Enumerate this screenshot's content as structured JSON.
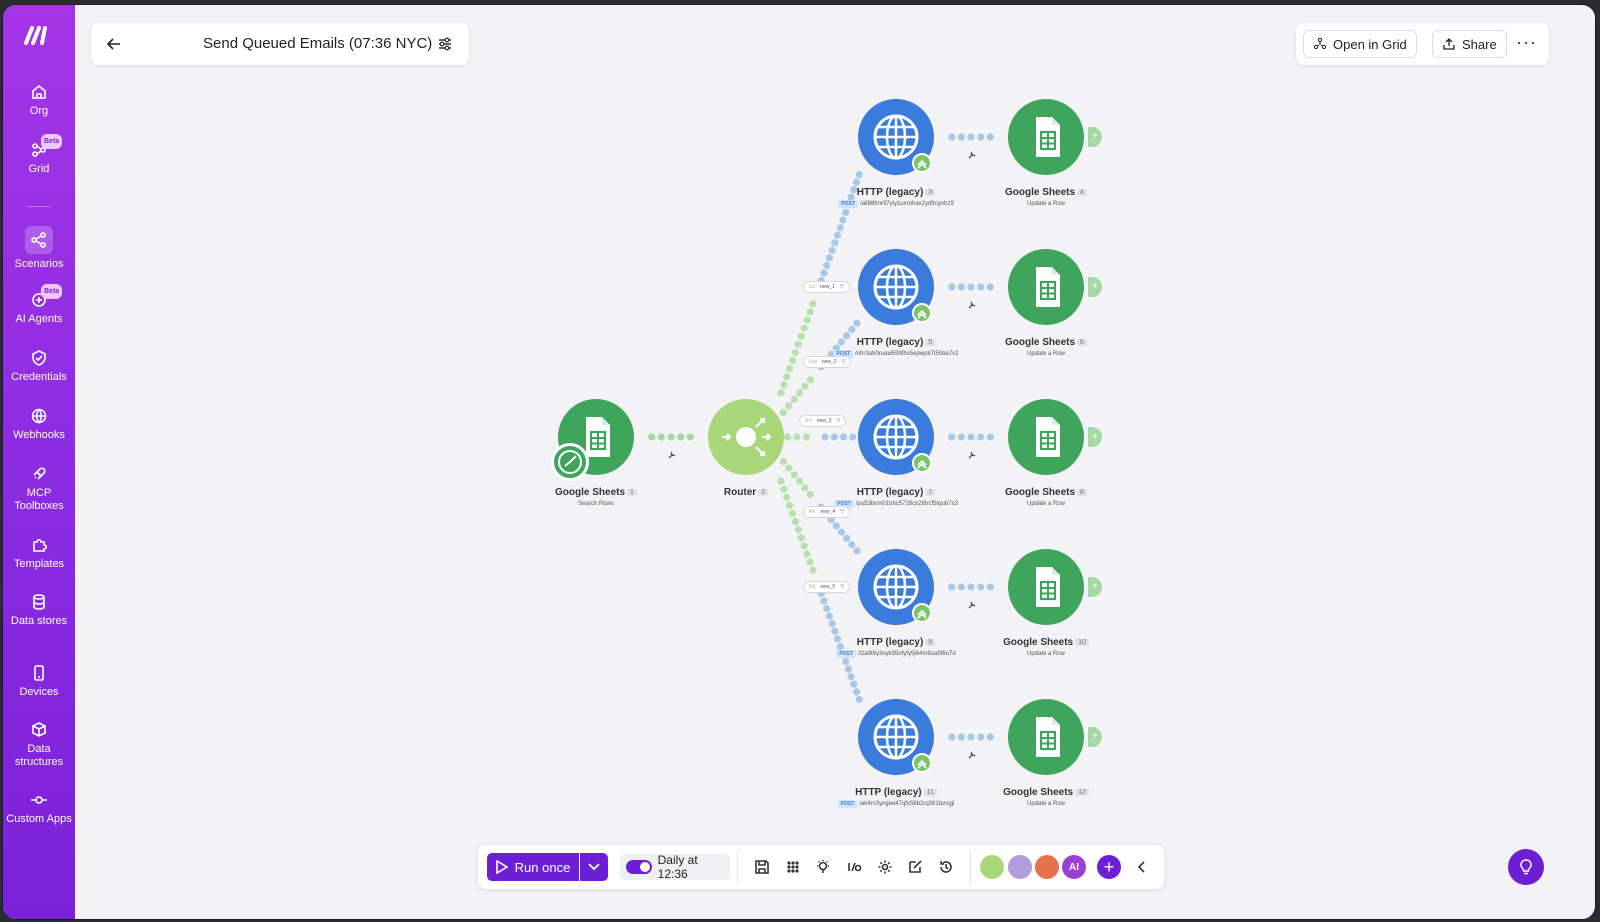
{
  "sidebar": {
    "items": [
      {
        "label": "Org",
        "icon": "home-icon"
      },
      {
        "label": "Grid",
        "icon": "grid-icon",
        "badge": "Beta"
      },
      {
        "label": "Scenarios",
        "icon": "share-icon"
      },
      {
        "label": "AI Agents",
        "icon": "ai-agents-icon",
        "badge": "Beta"
      },
      {
        "label": "Credentials",
        "icon": "shield-icon"
      },
      {
        "label": "Webhooks",
        "icon": "globe-icon"
      },
      {
        "label": "MCP Toolboxes",
        "icon": "mcp-icon"
      },
      {
        "label": "Templates",
        "icon": "puzzle-icon"
      },
      {
        "label": "Data stores",
        "icon": "database-icon"
      },
      {
        "label": "Devices",
        "icon": "device-icon"
      },
      {
        "label": "Data structures",
        "icon": "cube-icon"
      },
      {
        "label": "Custom Apps",
        "icon": "commit-icon"
      }
    ]
  },
  "header": {
    "title": "Send Queued Emails (07:36 NYC)",
    "open_in_grid": "Open in Grid",
    "share": "Share",
    "more": "···"
  },
  "scenario": {
    "trigger": {
      "name": "Google Sheets",
      "num": "1",
      "sub": "Search Rows"
    },
    "router": {
      "name": "Router",
      "num": "2"
    },
    "routes": [
      {
        "order": "1st",
        "label": "new_1",
        "http_num": "3",
        "http_url": "/all88fmr97yly1uxrohax2ydfrcyvhz9",
        "sheet_num": "4"
      },
      {
        "order": "2nd",
        "label": "new_2",
        "http_num": "5",
        "http_url": "/ohr3ah0ruaw599fhs5epwpk7t5hba7v2",
        "sheet_num": "6"
      },
      {
        "order": "3rd",
        "label": "new_3",
        "http_num": "7",
        "http_url": "/pu53bnm01bhc5728cv2t8rcf5tqub7s3",
        "sheet_num": "8"
      },
      {
        "order": "4th",
        "label": "new_4",
        "http_num": "9",
        "http_url": "/l2a9t6y3oyk95ofyfy5j64m9ua5f6n7d",
        "sheet_num": "10"
      },
      {
        "order": "5th",
        "label": "new_5",
        "http_num": "11",
        "http_url": "/ak4rs3yngee47qfx58b2rq381bvogji",
        "sheet_num": "12"
      }
    ],
    "http_name": "HTTP (legacy)",
    "method": "POST",
    "sheet_name": "Google Sheets",
    "sheet_sub": "Update a Row"
  },
  "toolbar": {
    "run_once": "Run once",
    "schedule": "Daily at 12:36",
    "schedule_on": true,
    "apps": [
      {
        "label": "",
        "color": "#a8d77a"
      },
      {
        "label": "",
        "color": "#b39ddb"
      },
      {
        "label": "",
        "color": "#e5734f"
      },
      {
        "label": "AI",
        "color": "#9b3fd6"
      }
    ]
  },
  "colors": {
    "sidebar": "#8a2be2",
    "http": "#3a7bdc",
    "sheets": "#3fa45c",
    "router": "#a8d77a",
    "accent": "#6d1fd6"
  }
}
